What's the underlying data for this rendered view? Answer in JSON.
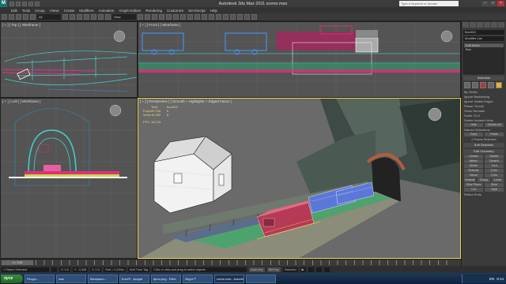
{
  "app": {
    "title": "Autodesk 3ds Max 2011   scene.max",
    "search_placeholder": "Type a keyword or phrase"
  },
  "menu": [
    "Edit",
    "Tools",
    "Group",
    "Views",
    "Create",
    "Modifiers",
    "Animation",
    "Graph Editors",
    "Rendering",
    "Customize",
    "MAXScript",
    "Help"
  ],
  "toolbar": {
    "selection_filter": "All",
    "view_dropdown": "View"
  },
  "viewports": {
    "top": {
      "label": "[ + ] [ Top ] [ Wireframe ]"
    },
    "front": {
      "label": "[ + ] [ Front ] [ Wireframe ]"
    },
    "left": {
      "label": "[ + ] [ Left ] [ Wireframe ]"
    },
    "perspective": {
      "label": "[ + ] [ Perspective ] [ Smooth + Highlights + Edged Faces ]"
    }
  },
  "stats": {
    "header_total": "Total",
    "header_obj": "Box003",
    "polys_label": "Polys:",
    "polys_total": "30 236",
    "polys_obj": "6",
    "verts_label": "Verts:",
    "verts_total": "18 982",
    "verts_obj": "8",
    "fps_label": "FPS:",
    "fps_value": "16,123"
  },
  "command_panel": {
    "object_name": "Box003",
    "modifier_list": "Modifier List",
    "stack": [
      "Edit Mesh",
      "Box"
    ],
    "selection_title": "Selection",
    "by_vertex": "By Vertex",
    "ignore_backfacing": "Ignore Backfacing",
    "ignore_visible_edges": "Ignore Visible Edges",
    "planar_thresh": "Planar Thresh",
    "show_normals": "Show Normals",
    "scale_label": "Scale:",
    "scale_value": "20,0",
    "delete_isolated": "Delete Isolated Verts",
    "hide": "Hide",
    "unhide_all": "Unhide All",
    "named_selections": "Named Selections:",
    "copy": "Copy",
    "paste": "Paste",
    "selected_count": "0 Faces Selected",
    "soft_selection": "Soft Selection",
    "edit_geometry": "Edit Geometry",
    "create": "Create",
    "delete": "Delete",
    "attach": "Attach",
    "detach": "Detach",
    "divide": "Divide",
    "turn": "Turn",
    "extrude": "Extrude",
    "extrude_val": "0,0m",
    "bevel": "Bevel",
    "bevel_val": "0,0m",
    "normal": "Normal:",
    "group": "Group",
    "local": "Local",
    "slice_plane": "Slice Plane",
    "slice": "Slice",
    "cut": "Cut",
    "split": "Split",
    "refine_ends": "Refine Ends"
  },
  "timeline": {
    "frame": "0 / 100"
  },
  "statusbar": {
    "selected": "1 Object Selected",
    "hint": "Click or click-and-drag to select objects",
    "x": "X: 0,0",
    "y": "Y: -3,348",
    "z": "Z: 0,0",
    "grid": "Grid = 0,254m",
    "add_time_tag": "Add Time Tag",
    "autokey": "Auto Key",
    "setkey": "Set Key",
    "selected_dropdown": "Selected"
  },
  "taskbar": {
    "start": "пуск",
    "tasks": [
      "Ресурс...",
      "max",
      "Материал...",
      "Блог® - форум",
      "фото.png - Paint",
      "Skype™",
      "scene.max - Autodesk...",
      ""
    ],
    "lang": "EN",
    "time": "9:14"
  },
  "colors": {
    "accent": "#f4d34a",
    "viewport_bg": "#545454",
    "wire_cyan": "#3fd3d3",
    "wire_magenta": "#e0307a",
    "wire_blue": "#4a8ce8"
  }
}
